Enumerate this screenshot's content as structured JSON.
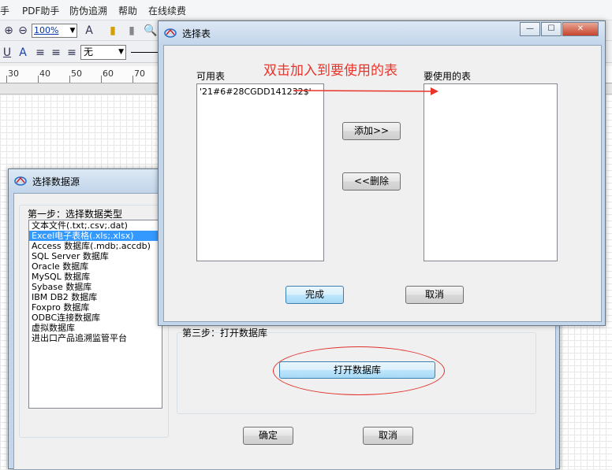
{
  "menubar": {
    "items": [
      "手",
      "PDF助手",
      "防伪追溯",
      "帮助",
      "在线续费"
    ]
  },
  "toolbar": {
    "zoom": "100%",
    "font_select": "无"
  },
  "ruler": {
    "labels": [
      "30",
      "40",
      "50",
      "60",
      "70"
    ]
  },
  "datasource_dialog": {
    "title": "选择数据源",
    "step1_label": "第一步：选择数据类型",
    "types": [
      "文本文件(.txt;.csv;.dat)",
      "Excel电子表格(.xls;.xlsx)",
      "Access 数据库(.mdb;.accdb)",
      "SQL Server 数据库",
      "Oracle 数据库",
      "MySQL 数据库",
      "Sybase 数据库",
      "IBM DB2 数据库",
      "Foxpro 数据库",
      "ODBC连接数据库",
      "虚拟数据库",
      "进出口产品追溯监管平台"
    ],
    "selected_index": 1,
    "step3_label": "第三步：打开数据库",
    "open_db_button": "打开数据库",
    "ok_button": "确定",
    "cancel_button": "取消"
  },
  "select_table_dialog": {
    "title": "选择表",
    "available_label": "可用表",
    "used_label": "要使用的表",
    "available_items": [
      "'21#6#28CGDD141232$'"
    ],
    "used_items": [],
    "add_button": "添加>>",
    "remove_button": "<<删除",
    "done_button": "完成",
    "cancel_button": "取消",
    "window_buttons": {
      "minimize": "—",
      "maximize": "☐",
      "close": "✕"
    }
  },
  "annotation": {
    "text": "双击加入到要使用的表",
    "color": "#e8342a"
  }
}
